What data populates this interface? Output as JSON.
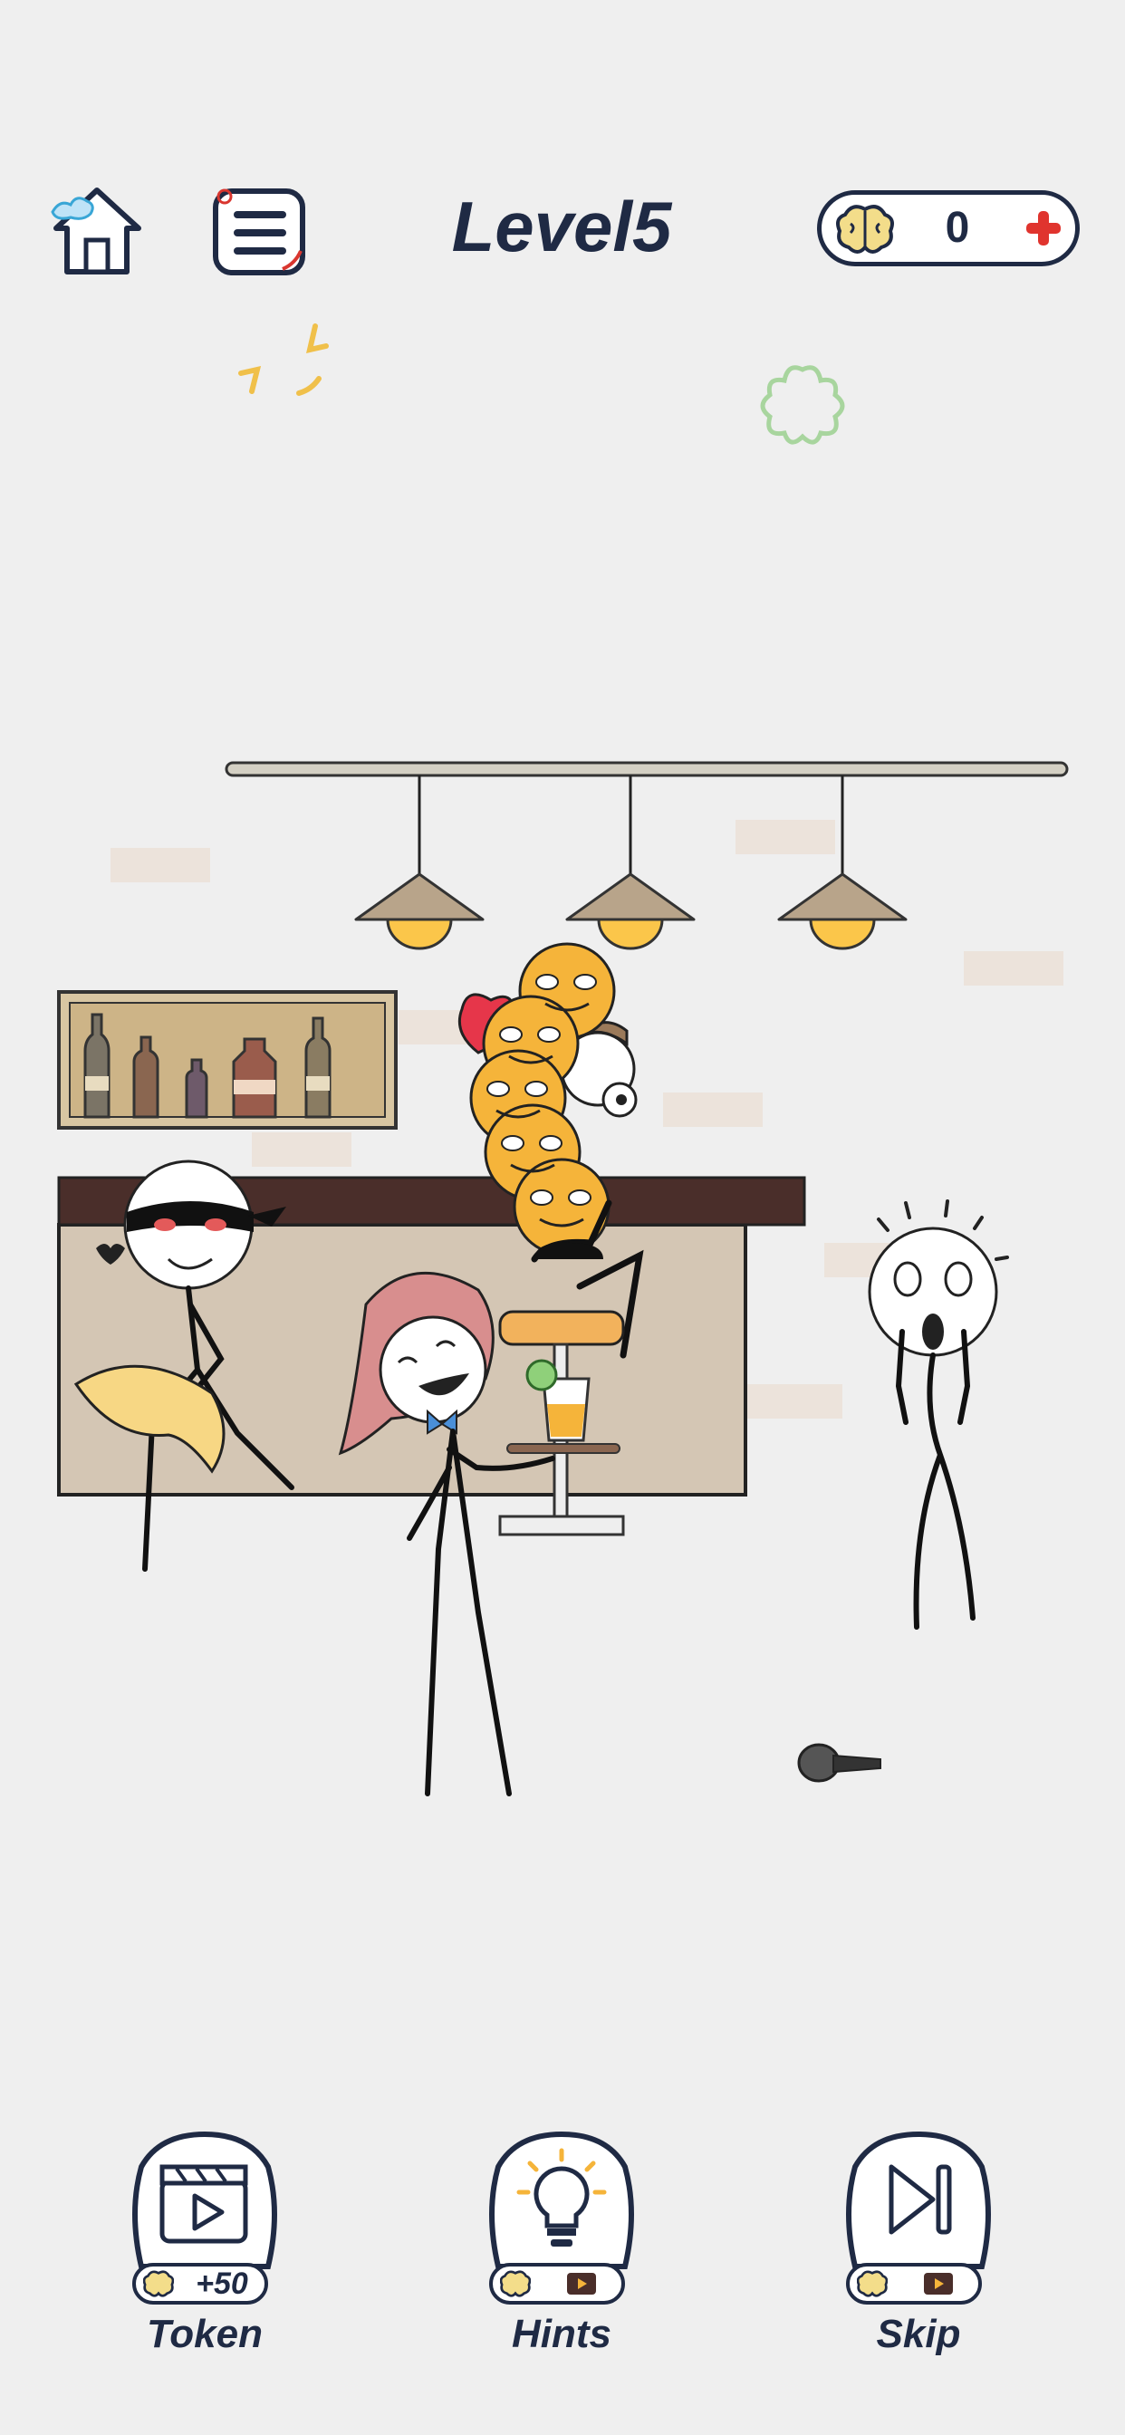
{
  "level": {
    "title": "Level5"
  },
  "tokens": {
    "count": "0"
  },
  "buttons": {
    "token": {
      "label": "Token",
      "reward": "+50"
    },
    "hints": {
      "label": "Hints"
    },
    "skip": {
      "label": "Skip"
    }
  },
  "icons": {
    "home": "home-icon",
    "menu": "menu-icon",
    "brain": "brain-icon",
    "add": "plus-icon",
    "video": "video-icon",
    "bulb": "lightbulb-icon",
    "skip": "skip-icon"
  },
  "colors": {
    "ink": "#1f2a44",
    "background": "#efefef",
    "bar_top": "#4a2e2a",
    "bar_front": "#d4c6b4",
    "emoji": "#f5b43a",
    "add": "#e0342e"
  }
}
